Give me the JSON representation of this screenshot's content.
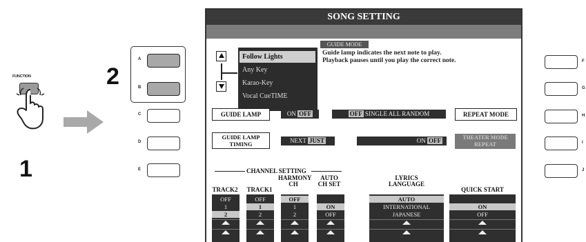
{
  "steps": {
    "one": "1",
    "two": "2"
  },
  "function_button": {
    "label": "FUNCTION"
  },
  "left_buttons": [
    {
      "letter": "A"
    },
    {
      "letter": "B"
    },
    {
      "letter": "C"
    },
    {
      "letter": "D"
    },
    {
      "letter": "E"
    }
  ],
  "right_buttons": [
    {
      "letter": "F"
    },
    {
      "letter": "G"
    },
    {
      "letter": "H"
    },
    {
      "letter": "I"
    },
    {
      "letter": "J"
    }
  ],
  "screen": {
    "title": "SONG SETTING",
    "guide_mode": {
      "label": "GUIDE MODE",
      "description_line1": "Guide lamp indicates the next note to play.",
      "description_line2": "Playback pauses until you play the correct note.",
      "items": [
        "Follow Lights",
        "Any Key",
        "Karao-Key",
        "Vocal CueTIME"
      ]
    },
    "guide_lamp": {
      "label": "GUIDE LAMP",
      "on": "ON",
      "off": "OFF"
    },
    "repeat_options": {
      "off": "OFF",
      "rest": "SINGLE ALL RANDOM"
    },
    "repeat_mode": {
      "label": "REPEAT MODE"
    },
    "guide_lamp_timing": {
      "label_line1": "GUIDE LAMP",
      "label_line2": "TIMING",
      "next": "NEXT",
      "just": "JUST"
    },
    "on_off_setting": {
      "on": "ON",
      "off": "OFF"
    },
    "theater_mode": {
      "label_line1": "THEATER MODE",
      "label_line2": "REPEAT"
    },
    "channel_setting": {
      "label": "CHANNEL SETTING"
    },
    "columns": {
      "track2": {
        "head1": "",
        "head2": "TRACK2",
        "cells": [
          "OFF",
          "1",
          "2"
        ]
      },
      "track1": {
        "head1": "",
        "head2": "TRACK1",
        "cells": [
          "OFF",
          "1",
          "2"
        ]
      },
      "harmony": {
        "head1": "HARMONY",
        "head2": "CH",
        "cells": [
          "OFF",
          "1",
          "2"
        ]
      },
      "auto": {
        "head1": "AUTO",
        "head2": "CH SET",
        "cells": [
          "",
          "ON",
          "OFF"
        ]
      },
      "lyrics": {
        "head1": "LYRICS",
        "head2": "LANGUAGE",
        "cells": [
          "AUTO",
          "INTERNATIONAL",
          "JAPANESE"
        ]
      },
      "quick": {
        "head1": "",
        "head2": "QUICK START",
        "cells": [
          "",
          "ON",
          "OFF"
        ]
      }
    }
  },
  "colors": {
    "screen_dark": "#2f2f2f",
    "title_bar": "#3a3a3a",
    "arrow": "#a9a9a9"
  }
}
